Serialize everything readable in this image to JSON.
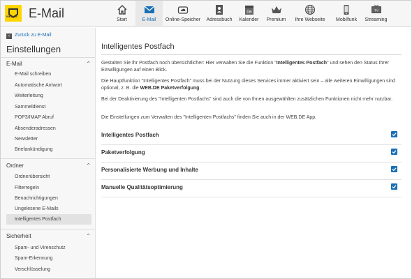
{
  "app": {
    "logo_text": "WEB.DE",
    "title": "E-Mail"
  },
  "nav": [
    {
      "label": "Start",
      "icon": "home-icon"
    },
    {
      "label": "E-Mail",
      "icon": "mail-icon",
      "active": true
    },
    {
      "label": "Online-Speicher",
      "icon": "cloud-icon"
    },
    {
      "label": "Adressbuch",
      "icon": "address-book-icon"
    },
    {
      "label": "Kalender",
      "icon": "calendar-icon",
      "day": "06"
    },
    {
      "label": "Premium",
      "icon": "crown-icon"
    },
    {
      "label": "Ihre Webseite",
      "icon": "globe-icon"
    },
    {
      "label": "Mobilfunk",
      "icon": "phone-icon"
    },
    {
      "label": "Streaming",
      "icon": "tv-icon"
    }
  ],
  "sidebar": {
    "back_label": "Zurück zu E-Mail",
    "title": "Einstellungen",
    "sections": [
      {
        "title": "E-Mail",
        "items": [
          "E-Mail schreiben",
          "Automatische Antwort",
          "Weiterleitung",
          "Sammeldienst",
          "POP3/IMAP Abruf",
          "Absenderadressen",
          "Newsletter",
          "Briefankündigung"
        ]
      },
      {
        "title": "Ordner",
        "items": [
          "Ordnerübersicht",
          "Filterregeln",
          "Benachrichtigungen",
          "Ungelesene E-Mails",
          "Intelligentes Postfach"
        ]
      },
      {
        "title": "Sicherheit",
        "items": [
          "Spam- und Virenschutz",
          "Spam-Erkennung",
          "Verschlüsselung"
        ]
      }
    ],
    "active_item": "Intelligentes Postfach"
  },
  "main": {
    "title": "Intelligentes Postfach",
    "para1_a": "Gestalten Sie Ihr Postfach noch übersichtlicher: Hier verwalten Sie die Funktion \"",
    "para1_b": "Intelligentes Postfach",
    "para1_c": "\" und sehen den Status Ihrer Einwilligungen auf einen Blick.",
    "para2_a": "Die Hauptfunktion \"Intelligentes Postfach\" muss bei der Nutzung dieses Services immer aktiviert sein – alle weiteren Einwilligungen sind optional, z. B. die ",
    "para2_b": "WEB.DE Paketverfolgung",
    "para2_c": ".",
    "para3": "Bei der Deaktivierung des \"Intelligenten Postfachs\" sind auch die von Ihnen ausgewählten zusätzlichen Funktionen nicht mehr nutzbar.",
    "para4": "Die Einstellungen zum Verwalten des \"Intelligenten Postfachs\" finden Sie auch in der WEB.DE App.",
    "options": [
      {
        "label": "Intelligentes Postfach",
        "checked": true
      },
      {
        "label": "Paketverfolgung",
        "checked": true
      },
      {
        "label": "Personalisierte Werbung und Inhalte",
        "checked": true
      },
      {
        "label": "Manuelle Qualitätsoptimierung",
        "checked": true
      }
    ]
  },
  "colors": {
    "accent": "#1a6fb5",
    "logo": "#ffd500"
  }
}
